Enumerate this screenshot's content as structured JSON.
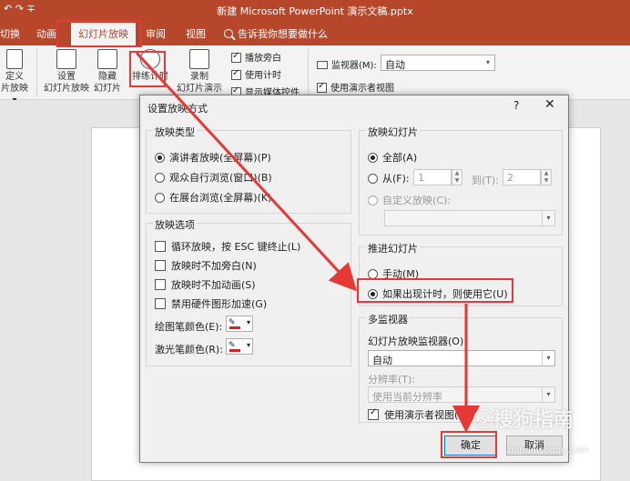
{
  "window": {
    "title": "新建 Microsoft PowerPoint 演示文稿.pptx",
    "quick_access": "↶ ↷ ∓"
  },
  "tabs": [
    {
      "label": "切换"
    },
    {
      "label": "动画"
    },
    {
      "label": "幻灯片放映"
    },
    {
      "label": "审阅"
    },
    {
      "label": "视图"
    }
  ],
  "tell_me": "告诉我你想要做什么",
  "ribbon": {
    "custom_show": [
      "定义",
      "片放映 ▾"
    ],
    "setup_show": [
      "设置",
      "幻灯片放映"
    ],
    "hide_slide": [
      "隐藏",
      "幻灯片"
    ],
    "rehearse": "排练计时",
    "record": [
      "录制",
      "幻灯片演示"
    ],
    "checks": [
      "播放旁白",
      "使用计时",
      "显示媒体控件"
    ],
    "monitor_label": "监视器(M):",
    "monitor_value": "自动",
    "presenter_view": "使用演示者视图"
  },
  "dialog": {
    "title": "设置放映方式",
    "help": "?",
    "close": "✕",
    "show_type": {
      "title": "放映类型",
      "options": [
        "演讲者放映(全屏幕)(P)",
        "观众自行浏览(窗口)(B)",
        "在展台浏览(全屏幕)(K)"
      ]
    },
    "show_options": {
      "title": "放映选项",
      "checks": [
        "循环放映，按 ESC 键终止(L)",
        "放映时不加旁白(N)",
        "放映时不加动画(S)",
        "禁用硬件图形加速(G)"
      ],
      "pen_color": "绘图笔颜色(E):",
      "laser_color": "激光笔颜色(R):"
    },
    "show_slides": {
      "title": "放映幻灯片",
      "all": "全部(A)",
      "from": "从(F):",
      "from_value": "1",
      "to": "到(T):",
      "to_value": "2",
      "custom": "自定义放映(C):"
    },
    "advance": {
      "title": "推进幻灯片",
      "manual": "手动(M)",
      "timings": "如果出现计时，则使用它(U)"
    },
    "monitors": {
      "title": "多监视器",
      "monitor_label": "幻灯片放映监视器(O):",
      "monitor_value": "自动",
      "resolution_label": "分辨率(T):",
      "resolution_value": "使用当前分辨率",
      "presenter_view": "使用演示者视图(V)"
    },
    "ok": "确定",
    "cancel": "取消"
  },
  "watermark": {
    "logo": "ⓢ搜狗指南",
    "url": "zhinan.sogou.com"
  },
  "colors": {
    "accent": "#b7472a",
    "highlight": "#e53935",
    "pen": "#e02020"
  }
}
